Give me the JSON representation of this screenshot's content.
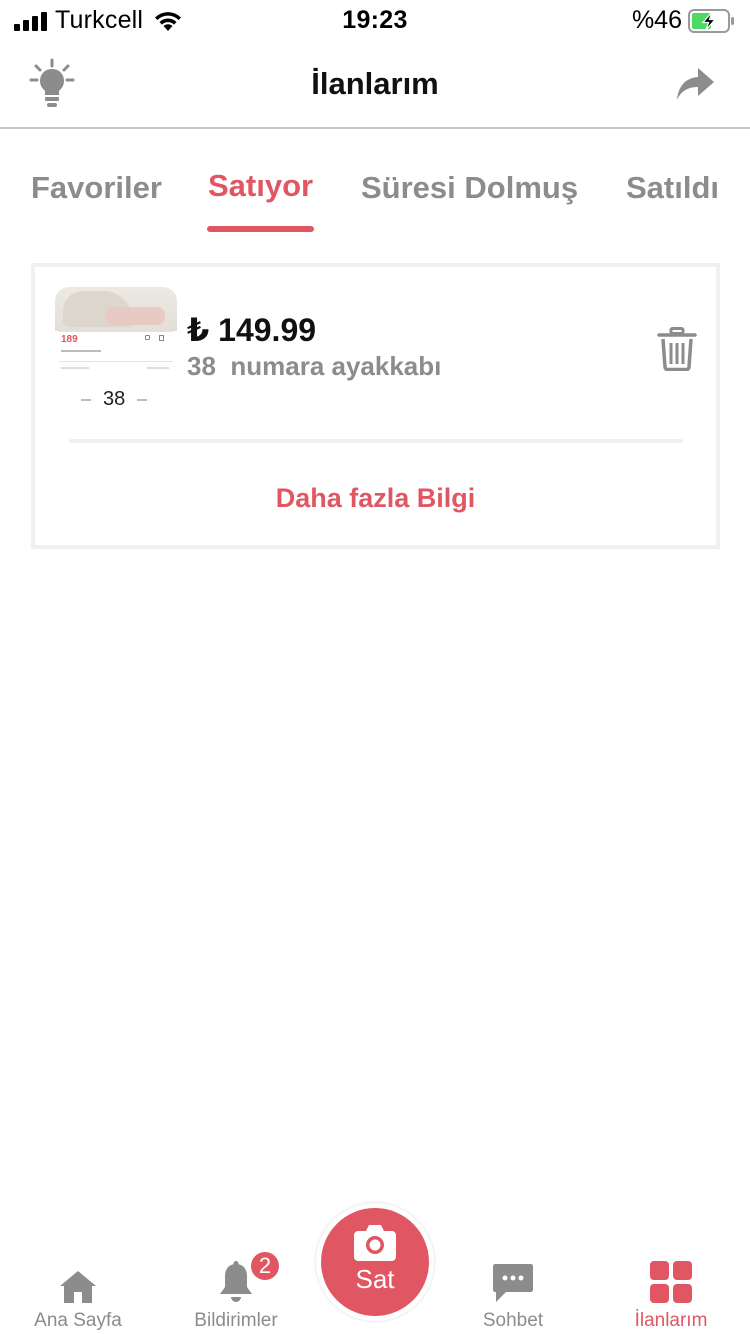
{
  "status_bar": {
    "carrier": "Turkcell",
    "time": "19:23",
    "battery": "%46"
  },
  "nav": {
    "title": "İlanlarım",
    "left_icon": "lightbulb-icon",
    "right_icon": "share-arrow-icon"
  },
  "tabs": [
    {
      "label": "Favoriler",
      "active": false
    },
    {
      "label": "Satıyor",
      "active": true
    },
    {
      "label": "Süresi Dolmuş",
      "active": false
    },
    {
      "label": "Satıldı",
      "active": false
    }
  ],
  "listing": {
    "price": "₺ 149.99",
    "description": "38  numara ayakkabı",
    "thumb_price": "189",
    "thumb_size": "38",
    "more_info": "Daha fazla Bilgi"
  },
  "tabbar": {
    "items": [
      {
        "label": "Ana Sayfa",
        "icon": "home-icon",
        "active": false
      },
      {
        "label": "Bildirimler",
        "icon": "bell-icon",
        "active": false,
        "badge": "2"
      },
      {
        "label": "Sohbet",
        "icon": "chat-icon",
        "active": false
      },
      {
        "label": "İlanlarım",
        "icon": "grid-icon",
        "active": true
      }
    ],
    "sell_label": "Sat"
  },
  "colors": {
    "accent": "#e05763",
    "muted_text": "#8c8c8c"
  }
}
